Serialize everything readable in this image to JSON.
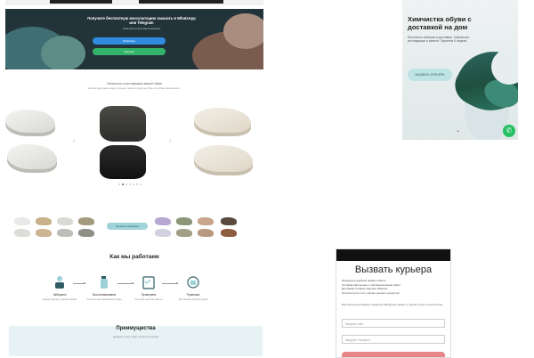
{
  "desktop": {
    "hero": {
      "title": "Получите бесплатную консультацию заказать в WhatsApp или Telegram",
      "subtitle": "Ответим на все ваши вопросы",
      "whatsapp_button": "WhatsApp",
      "telegram_button": "Telegram"
    },
    "shoes_block": {
      "title": "Химчистка и реставрация вашей обуви",
      "subtitle": "Чистим кроссовки, кеды, ботинки, сапоги и другую обувь из любых материалов"
    },
    "carousel": {
      "dot_count": 7,
      "active_dot": 1
    },
    "more_button": "Больше примеров",
    "how_we_work": {
      "title": "Как мы работаем",
      "steps": [
        {
          "label": "Забираем",
          "text": "Курьер приедет в удобное время"
        },
        {
          "label": "Восстанавливаем",
          "text": "Чистим и восстанавливаем обувь"
        },
        {
          "label": "Проверяем",
          "text": "Контроль качества работы"
        },
        {
          "label": "Привозим",
          "text": "Доставляем обратно домой"
        }
      ]
    },
    "advantages": {
      "title": "Преимущества",
      "subtitle": "Доверьте свою обувь профессионалам"
    }
  },
  "mobile": {
    "title": "Химчистка обуви с доставкой на дом",
    "subtitle": "Бесплатно заберем и доставим. Химчистка, реставрация и ремонт. Гарантия 6 недель.",
    "cta_button": "ВЫЗВАТЬ КУРЬЕРА"
  },
  "modal": {
    "title": "Вызвать курьера",
    "bullets": [
      "Приедем в удобное время и место",
      "Оставим квитанцию с описанием видов работ",
      "Доставим готовые изделия обратно",
      "Оплата после того, как вы оцените результат"
    ],
    "note": "Бесплатная доставка в пределах МКАД при заказе от одной услуги и количества",
    "name_placeholder": "Введите имя",
    "phone_placeholder": "Введите телефон"
  },
  "colors": {
    "accent_teal": "#9fd4d9",
    "whatsapp_green": "#25c063",
    "telegram_blue": "#2f8ce0",
    "submit_pink": "#e58585"
  },
  "icons": [
    "courier-icon",
    "spray-bottle-icon",
    "checklist-icon",
    "delivery-icon",
    "whatsapp-icon",
    "chevron-left-icon",
    "chevron-right-icon",
    "chevron-down-icon"
  ]
}
